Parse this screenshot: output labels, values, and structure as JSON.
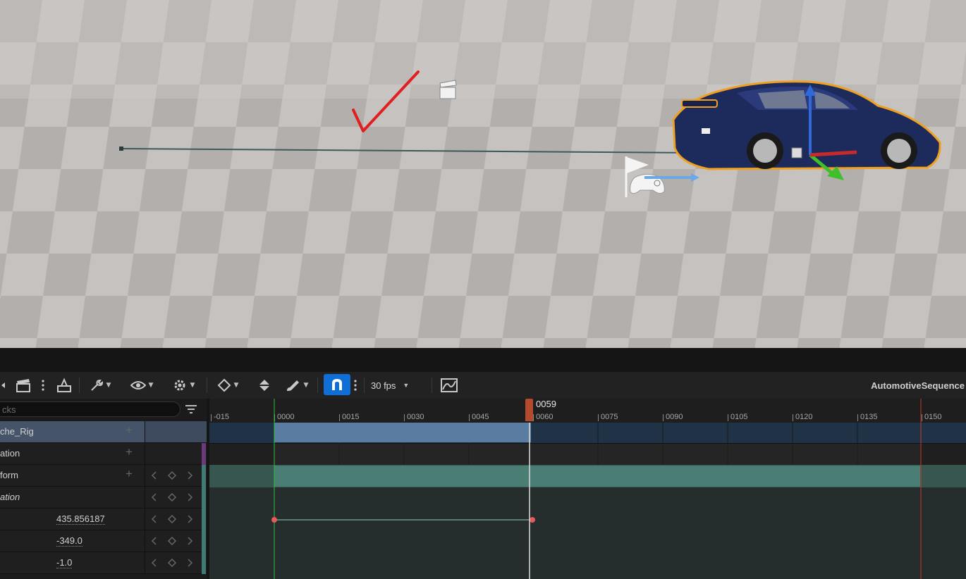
{
  "viewport": {
    "icons": [
      "checkmark-icon",
      "clapperboard-icon",
      "player-start-flag-icon",
      "gamepad-icon",
      "transform-gizmo-icon"
    ]
  },
  "toolbar": {
    "fps_label": "30 fps",
    "sequence_name": "AutomotiveSequence",
    "icons": [
      "back-arrow-icon",
      "clapperboard-icon",
      "more-icon",
      "render-movie-icon",
      "wrench-icon",
      "eye-icon",
      "gear-icon",
      "key-diamond-icon",
      "key-tangent-icon",
      "brush-icon",
      "snap-magnet-icon",
      "curve-editor-icon"
    ],
    "accent": "#0f6fd6"
  },
  "outliner": {
    "search_placeholder": "cks",
    "rows": [
      {
        "label": "che_Rig",
        "value": ""
      },
      {
        "label": "ation",
        "value": ""
      },
      {
        "label": "form",
        "value": ""
      },
      {
        "label": "ation",
        "value": ""
      },
      {
        "label": "",
        "value": "435.856187"
      },
      {
        "label": "",
        "value": "-349.0"
      },
      {
        "label": "",
        "value": "-1.0"
      }
    ]
  },
  "timeline": {
    "ticks": [
      "-015",
      "0000",
      "0015",
      "0030",
      "0045",
      "0060",
      "0075",
      "0090",
      "0105",
      "0120",
      "0135",
      "0150"
    ],
    "playhead": "0059",
    "start_color": "#2fbf3a",
    "end_color": "#c0392b"
  }
}
